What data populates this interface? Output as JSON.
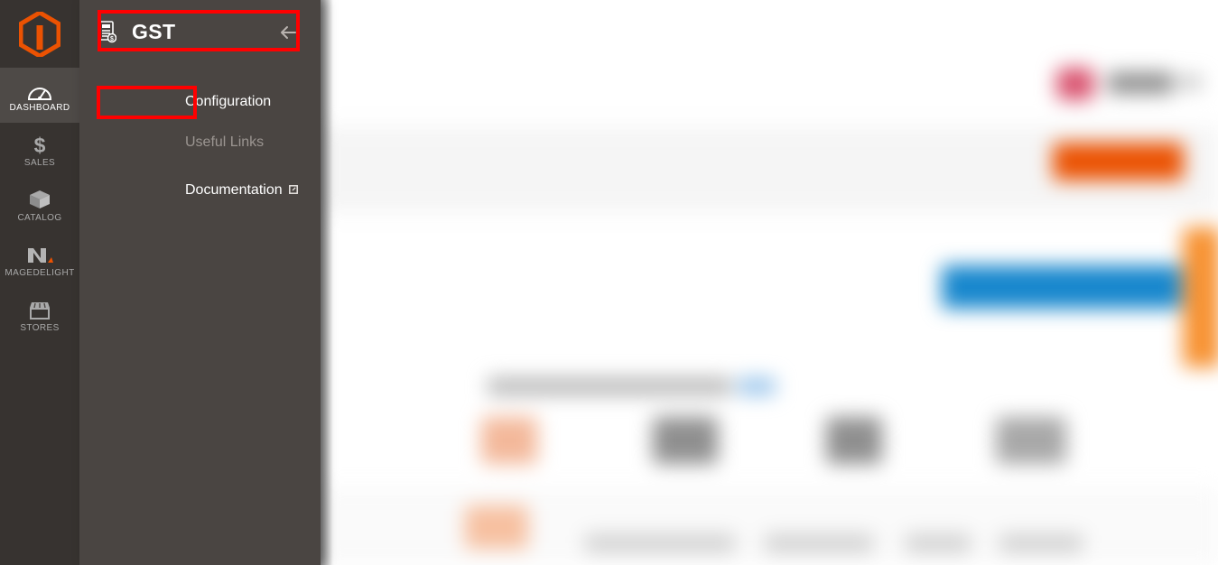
{
  "app": {
    "logo": "magento-logo",
    "primary_nav": [
      {
        "label": "DASHBOARD",
        "icon": "dashboard-gauge-icon",
        "active": true
      },
      {
        "label": "SALES",
        "icon": "dollar-sign-icon",
        "active": false
      },
      {
        "label": "CATALOG",
        "icon": "box-cube-icon",
        "active": false
      },
      {
        "label": "MAGEDELIGHT",
        "icon": "magedelight-m-icon",
        "active": false
      },
      {
        "label": "STORES",
        "icon": "storefront-icon",
        "active": false
      }
    ]
  },
  "flyout": {
    "title": "GST",
    "title_icon": "gst-invoice-document-icon",
    "back_icon": "arrow-left-icon",
    "items": [
      {
        "label": "Configuration",
        "type": "link",
        "highlighted": true
      },
      {
        "label": "Useful Links",
        "type": "heading",
        "highlighted": false
      },
      {
        "label": "Documentation",
        "type": "link",
        "highlighted": false,
        "external_icon": "external-link-icon"
      }
    ]
  },
  "annotations": {
    "highlight_color": "#ff0000",
    "boxes": [
      {
        "target": "gst-flyout-title"
      },
      {
        "target": "configuration-menu-item"
      }
    ]
  },
  "colors": {
    "left_nav_bg": "#373330",
    "flyout_bg": "#4a4542",
    "nav_active_bg": "#4e4a47",
    "magento_orange": "#eb5202",
    "accent_blue": "#1787cd",
    "accent_orange": "#f79232",
    "highlight_red": "#ff0000",
    "muted_text": "#9b9591"
  },
  "background_content": {
    "blurred": true,
    "description": "Magento admin page content behind the open GST flyout menu"
  }
}
